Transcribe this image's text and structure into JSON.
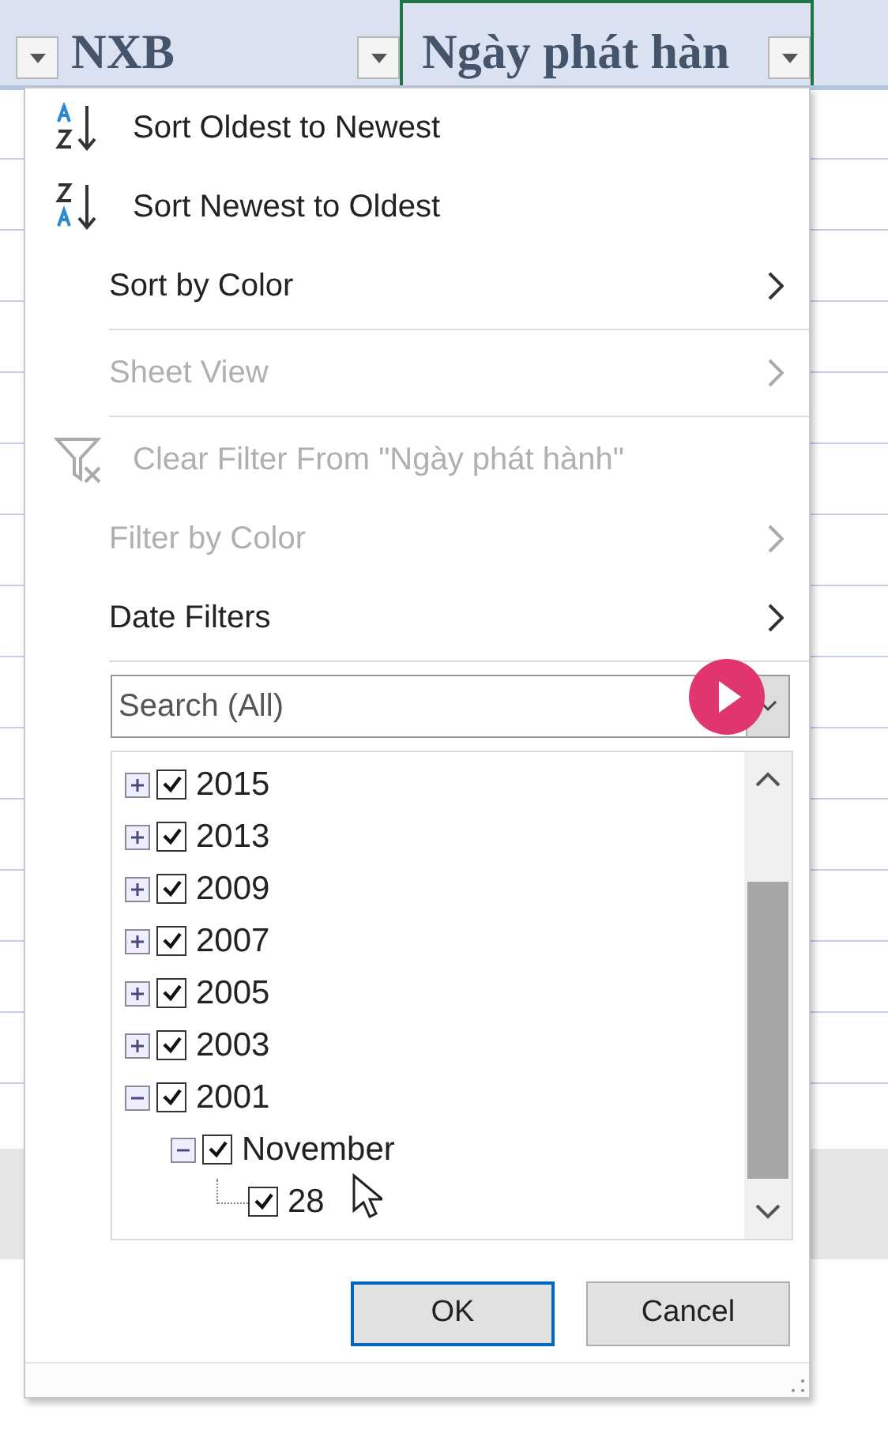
{
  "columns": [
    {
      "filter": true,
      "selected": false
    },
    {
      "label": "NXB",
      "filter": true,
      "selected": false
    },
    {
      "label": "Ngày phát hàn",
      "filter": true,
      "selected": true
    }
  ],
  "menu": {
    "items": [
      {
        "kind": "sort_ascending",
        "label": "Sort Oldest to Newest",
        "disabled": false,
        "submenu": false
      },
      {
        "kind": "sort_descending",
        "label": "Sort Newest to Oldest",
        "disabled": false,
        "submenu": false
      },
      {
        "kind": "plain",
        "label": "Sort by Color",
        "disabled": false,
        "submenu": true
      },
      {
        "kind": "separator"
      },
      {
        "kind": "plain",
        "label": "Sheet View",
        "disabled": true,
        "submenu": true
      },
      {
        "kind": "separator"
      },
      {
        "kind": "clear_filter",
        "label": "Clear Filter From \"Ngày phát hành\"",
        "disabled": true,
        "submenu": false
      },
      {
        "kind": "plain",
        "label": "Filter by Color",
        "disabled": true,
        "submenu": true
      },
      {
        "kind": "plain",
        "label": "Date Filters",
        "disabled": false,
        "submenu": true
      },
      {
        "kind": "separator"
      }
    ],
    "search": {
      "placeholder": "Search (All)"
    },
    "tree": [
      {
        "label": "2015",
        "checked": true,
        "expanded": false
      },
      {
        "label": "2013",
        "checked": true,
        "expanded": false
      },
      {
        "label": "2009",
        "checked": true,
        "expanded": false
      },
      {
        "label": "2007",
        "checked": true,
        "expanded": false
      },
      {
        "label": "2005",
        "checked": true,
        "expanded": false
      },
      {
        "label": "2003",
        "checked": true,
        "expanded": false
      },
      {
        "label": "2001",
        "checked": true,
        "expanded": true,
        "children": [
          {
            "label": "November",
            "checked": true,
            "expanded": true,
            "children": [
              {
                "label": "28",
                "checked": true
              }
            ]
          }
        ]
      }
    ],
    "buttons": [
      {
        "label": "OK",
        "selected": true
      },
      {
        "label": "Cancel",
        "selected": false
      }
    ]
  }
}
